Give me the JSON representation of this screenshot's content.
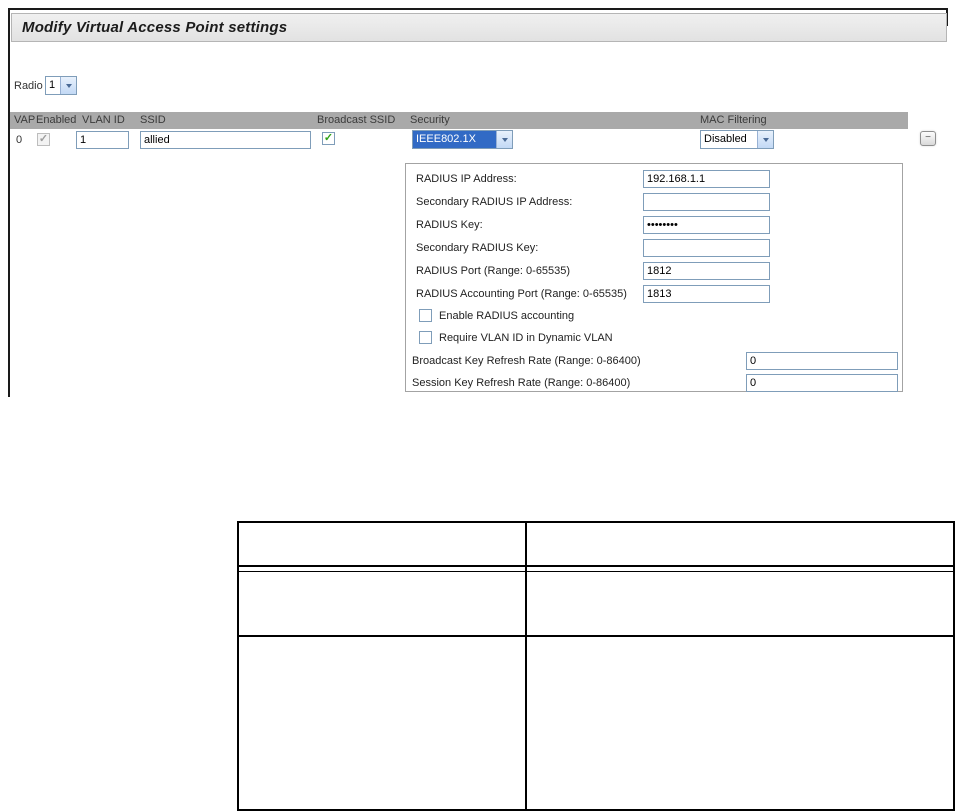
{
  "title": "Modify Virtual Access Point settings",
  "radio": {
    "label": "Radio",
    "value": "1"
  },
  "vap_table": {
    "headers": {
      "vap": "VAP",
      "enabled": "Enabled",
      "vlan_id": "VLAN ID",
      "ssid": "SSID",
      "broadcast_ssid": "Broadcast SSID",
      "security": "Security",
      "mac_filtering": "MAC Filtering"
    },
    "row0": {
      "vap": "0",
      "enabled_check": "✓",
      "vlan_id": "1",
      "ssid": "allied",
      "broadcast_check": "✓",
      "security_value": "IEEE802.1X",
      "mac_filtering_value": "Disabled"
    }
  },
  "radius_panel": {
    "fields": [
      {
        "label": "RADIUS IP Address:",
        "value": "192.168.1.1"
      },
      {
        "label": "Secondary RADIUS IP Address:",
        "value": ""
      },
      {
        "label": "RADIUS Key:",
        "value": "••••••••"
      },
      {
        "label": "Secondary RADIUS Key:",
        "value": ""
      },
      {
        "label": "RADIUS Port (Range: 0-65535)",
        "value": "1812"
      },
      {
        "label": "RADIUS Accounting Port (Range: 0-65535)",
        "value": "1813"
      }
    ],
    "checkboxes": [
      {
        "label": "Enable RADIUS accounting",
        "checked": false
      },
      {
        "label": "Require VLAN ID in Dynamic VLAN",
        "checked": false
      }
    ],
    "rate_fields": [
      {
        "label": "Broadcast Key Refresh Rate (Range: 0-86400)",
        "value": "0"
      },
      {
        "label": "Session Key Refresh Rate (Range: 0-86400)",
        "value": "0"
      }
    ]
  },
  "remove_button": {
    "glyph": "−"
  },
  "doc_table": {
    "cells": [
      "",
      "",
      "",
      "",
      "",
      ""
    ]
  }
}
